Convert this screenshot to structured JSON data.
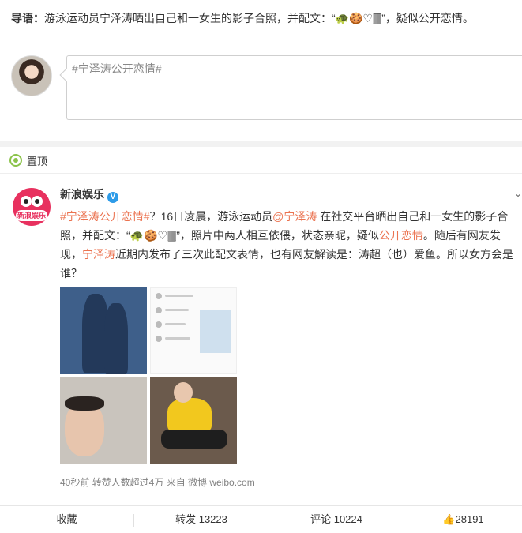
{
  "guide": {
    "label": "导语：",
    "text": "游泳运动员宁泽涛晒出自己和一女生的影子合照，并配文：“🐢🍪♡🀫”，疑似公开恋情。"
  },
  "compose": {
    "text": "#宁泽涛公开恋情#"
  },
  "pinned": {
    "label": "置顶"
  },
  "post": {
    "author": "新浪娱乐",
    "avatar_tag": "新浪娱乐",
    "verified_mark": "V",
    "more_icon": "chevron-down",
    "text_parts": [
      "#宁泽涛公开恋情#",
      "？16日凌晨，游泳运动员",
      "@宁泽涛",
      " 在社交平台晒出自己和一女生的影子合照，并配文：“🐢🍪♡🀫”，照片中两人相互依偎，状态亲昵，疑似",
      "公开恋情",
      "。随后有网友发现，",
      "宁泽涛",
      "近期内发布了三次此配文表情，也有网友解读是：涛超（也）爱鱼。所以女方会是谁？"
    ],
    "meta": "40秒前 转赞人数超过4万 来自 微博 weibo.com"
  },
  "actions": {
    "favorite": "收藏",
    "repost": "转发 13223",
    "comment": "评论 10224",
    "like": "28191"
  },
  "colors": {
    "link": "#eb7350",
    "verified": "#2d9be8",
    "pin": "#8bc34a"
  }
}
